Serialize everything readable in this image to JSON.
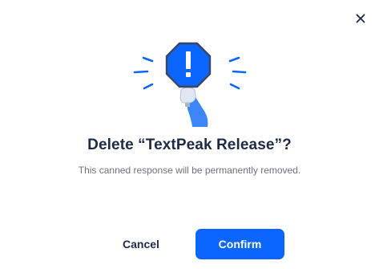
{
  "dialog": {
    "title": "Delete “TextPeak Release”?",
    "message": "This canned response will be permanently removed.",
    "cancel_label": "Cancel",
    "confirm_label": "Confirm",
    "close_icon": "close-icon",
    "illustration_icon": "warning-sign-icon"
  },
  "colors": {
    "accent": "#0a66ff",
    "title_text": "#1f2a44",
    "muted_text": "#6b7280",
    "sign_light": "#3d86f7"
  }
}
